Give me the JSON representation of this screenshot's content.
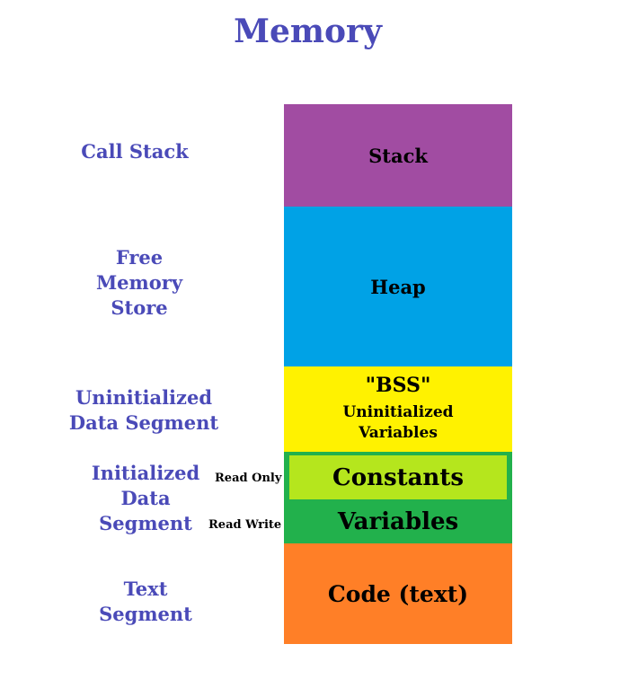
{
  "title": "Memory",
  "side_labels": {
    "call_stack": "Call Stack",
    "free_memory": [
      "Free",
      "Memory",
      "Store"
    ],
    "uninitialized": [
      "Uninitialized",
      "Data Segment"
    ],
    "initialized": [
      "Initialized",
      "Data",
      "Segment"
    ],
    "text": [
      "Text",
      "Segment"
    ]
  },
  "notes": {
    "read_only": "Read Only",
    "read_write": "Read Write"
  },
  "blocks": {
    "stack": {
      "label": "Stack",
      "color": "#a14ca2"
    },
    "heap": {
      "label": "Heap",
      "color": "#00a2e6"
    },
    "bss": {
      "label": "\"BSS\"",
      "sub": [
        "Uninitialized",
        "Variables"
      ],
      "color": "#fff200"
    },
    "initialized": {
      "constants": "Constants",
      "variables": "Variables",
      "outer_color": "#22b14c",
      "inner_color": "#b5e61d"
    },
    "text": {
      "label": "Code (text)",
      "color": "#ff7f27"
    }
  },
  "colors": {
    "label_text": "#4a4ab8"
  }
}
